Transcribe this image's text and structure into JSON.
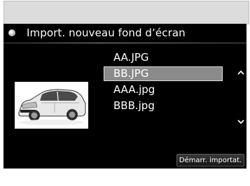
{
  "header": {
    "icon": "disc-bullet-icon",
    "title": "Import. nouveau fond d’écran"
  },
  "preview": {
    "icon": "car-thumbnail"
  },
  "files": {
    "items": [
      "AA.JPG",
      "BB.JPG",
      "AAA.jpg",
      "BBB.jpg"
    ],
    "selected_index": 1
  },
  "scroll": {
    "up_icon": "chevron-up-icon",
    "down_icon": "chevron-down-icon"
  },
  "actions": {
    "import_label": "Démarr. importat."
  },
  "colors": {
    "screen_bg": "#000000",
    "selection_bg": "#8a8a8a",
    "frame_bg": "#dcdcdc"
  }
}
